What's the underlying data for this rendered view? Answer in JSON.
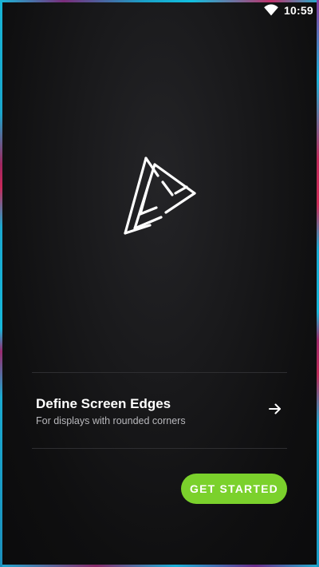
{
  "status_bar": {
    "time": "10:59",
    "wifi_icon": "wifi-icon"
  },
  "logo": {
    "icon": "triangle-logo-icon"
  },
  "setup_item": {
    "title": "Define Screen Edges",
    "subtitle": "For displays with rounded corners",
    "icon": "arrow-right-icon"
  },
  "cta": {
    "label": "GET STARTED",
    "color": "#7bd12c"
  },
  "colors": {
    "background": "#0b0b0c",
    "edge_cyan": "#17b5d6",
    "edge_magenta": "#c8285a"
  }
}
